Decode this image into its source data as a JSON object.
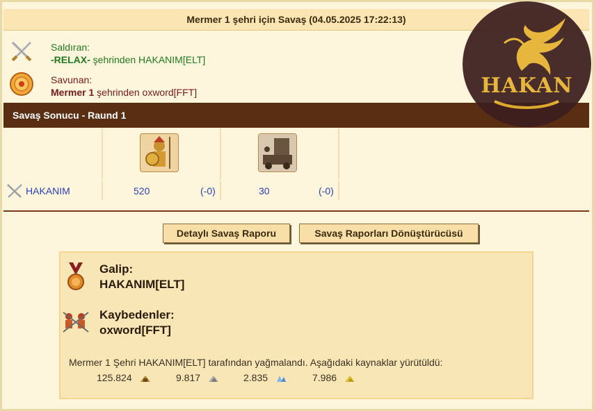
{
  "title": "Mermer 1 şehri için Savaş (04.05.2025 17:22:13)",
  "attacker": {
    "label": "Saldıran:",
    "city": "-RELAX-",
    "from_text": " şehrinden HAKANIM[ELT]",
    "icon": "crossed-swords-icon"
  },
  "defender": {
    "label": "Savunan:",
    "city": "Mermer 1",
    "from_text": " şehrinden oxword[FFT]",
    "icon": "shield-icon"
  },
  "result_header": "Savaş Sonucu - Raund 1",
  "units": [
    {
      "icon": "hoplite-unit-icon",
      "count": "520",
      "loss": "(-0)"
    },
    {
      "icon": "battering-ram-unit-icon",
      "count": "30",
      "loss": "(-0)"
    }
  ],
  "player_row": {
    "name": "HAKANIM",
    "icon": "crossed-swords-icon"
  },
  "buttons": {
    "detailed_report": "Detaylı Savaş Raporu",
    "converter": "Savaş Raporları Dönüştürücüsü"
  },
  "winner": {
    "label": "Galip:",
    "name": "HAKANIM[ELT]",
    "icon": "medal-icon"
  },
  "losers": {
    "label": "Kaybedenler:",
    "name": "oxword[FFT]",
    "icon": "fallen-soldiers-icon"
  },
  "loot_text": "Mermer 1 Şehri HAKANIM[ELT] tarafından yağmalandı. Aşağıdaki kaynaklar yürütüldü:",
  "loot": [
    {
      "value": "125.824",
      "icon": "wood-icon"
    },
    {
      "value": "9.817",
      "icon": "marble-icon"
    },
    {
      "value": "2.835",
      "icon": "crystal-icon"
    },
    {
      "value": "7.986",
      "icon": "sulfur-icon"
    }
  ],
  "logo": {
    "text": "HAKAN",
    "color": "#e6b230"
  },
  "colors": {
    "header_brown": "#5a2e12",
    "attacker_green": "#1f7a1f",
    "defender_red": "#7a1a1a",
    "count_blue": "#2a3fb8"
  }
}
